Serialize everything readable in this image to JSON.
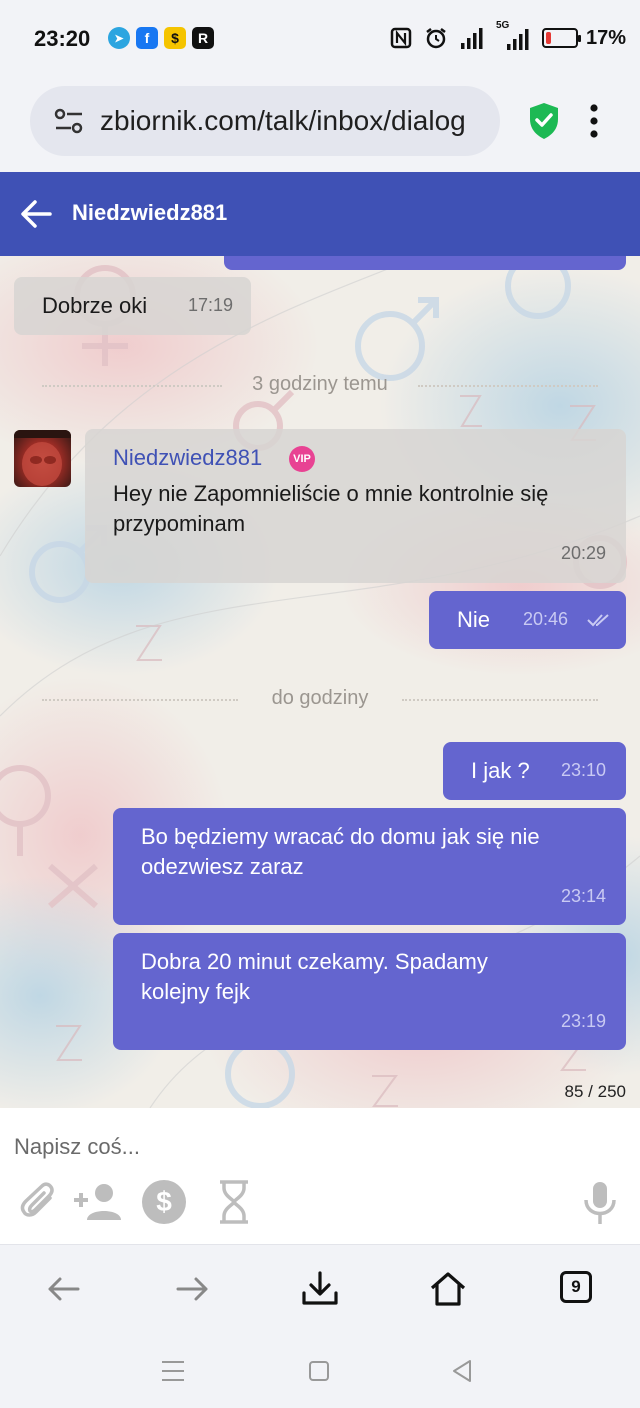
{
  "status_bar": {
    "time": "23:20",
    "apps": [
      {
        "name": "telegram-icon",
        "glyph": "➤",
        "color": "#2ca5e0"
      },
      {
        "name": "facebook-icon",
        "glyph": "f",
        "color": "#1877f2"
      },
      {
        "name": "app-yellow-icon",
        "glyph": "$",
        "color": "#f5c400"
      },
      {
        "name": "app-r-icon",
        "glyph": "R",
        "color": "#111111"
      }
    ],
    "network": "5G",
    "battery": "17%",
    "battery_level": 0.17
  },
  "browser": {
    "url": "zbiornik.com/talk/inbox/dialog",
    "open_tabs": "9"
  },
  "header": {
    "title": "Niedzwiedz881"
  },
  "messages": [
    {
      "text": "Dobrze oki",
      "time": "17:19"
    },
    {
      "divider": "3 godziny temu"
    },
    {
      "sender": "Niedzwiedz881",
      "badge": "VIP",
      "text_lines": [
        "Hey nie Zapomnieliście o mnie kontrolnie się",
        "przypominam"
      ],
      "time": "20:29"
    },
    {
      "text": "Nie",
      "time": "20:46"
    },
    {
      "divider": "do godziny"
    },
    {
      "text": "I jak ?",
      "time": "23:10"
    },
    {
      "text_lines": [
        "Bo będziemy wracać do domu jak się nie",
        "odezwiesz zaraz"
      ],
      "time": "23:14"
    },
    {
      "text_lines": [
        "Dobra 20 minut czekamy. Spadamy",
        "kolejny fejk"
      ],
      "time": "23:19"
    }
  ],
  "composer": {
    "char_counter": "85 / 250",
    "placeholder": "Napisz coś..."
  },
  "colors": {
    "primary": "#3f51b5",
    "outgoing_bubble": "#6465cf",
    "incoming_bubble": "#d7d5d2",
    "vip_badge": "#e84393",
    "shield": "#1db954"
  }
}
